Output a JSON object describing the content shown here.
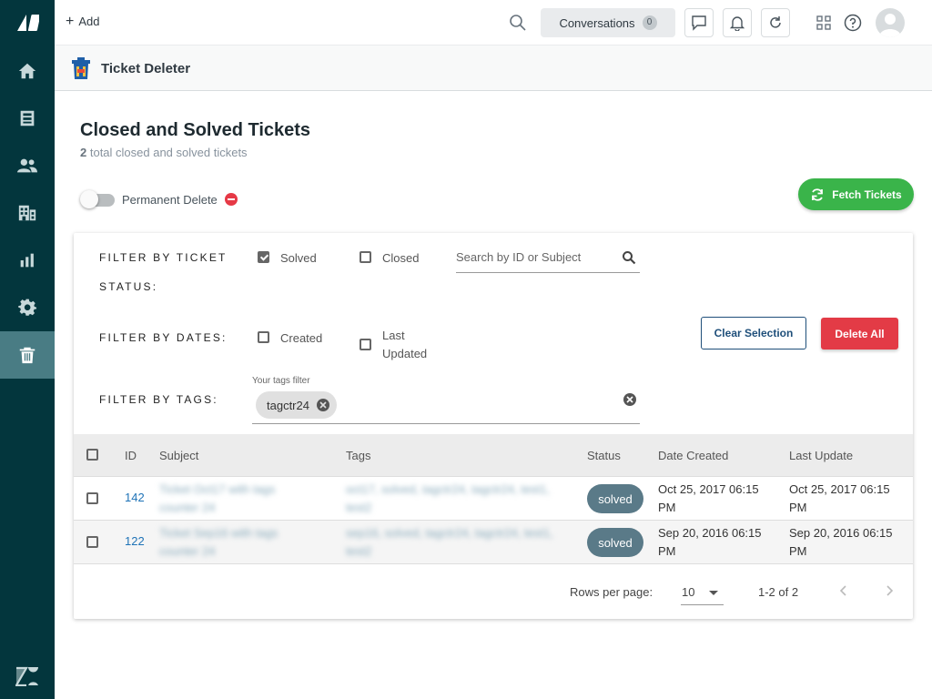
{
  "topbar": {
    "add_label": "Add",
    "conversations_label": "Conversations",
    "conversations_count": "0"
  },
  "app": {
    "title": "Ticket Deleter"
  },
  "page": {
    "title": "Closed and Solved Tickets",
    "total_count": "2",
    "total_suffix": " total closed and solved tickets"
  },
  "toggle": {
    "label": "Permanent Delete",
    "state": "off"
  },
  "fetch_button": "Fetch Tickets",
  "filters": {
    "status_label": "FILTER BY TICKET STATUS:",
    "dates_label": "FILTER BY DATES:",
    "tags_label": "FILTER BY TAGS:",
    "status_options": [
      {
        "label": "Solved",
        "checked": true
      },
      {
        "label": "Closed",
        "checked": false
      }
    ],
    "date_options": [
      {
        "label": "Created",
        "checked": false
      },
      {
        "label": "Last Updated",
        "checked": false
      }
    ],
    "search_placeholder": "Search by ID or Subject",
    "tags_caption": "Your tags filter",
    "tag_chips": [
      "tagctr24"
    ]
  },
  "actions": {
    "clear_label": "Clear Selection",
    "delete_label": "Delete All"
  },
  "table": {
    "columns": [
      "ID",
      "Subject",
      "Tags",
      "Status",
      "Date Created",
      "Last Update"
    ],
    "rows": [
      {
        "id": "142",
        "subject": "Ticket Oct17 with tags counter 24",
        "tags": "oct17, solved, tagctr24, tagctr24, test1, test2",
        "status": "solved",
        "created": "Oct 25, 2017 06:15 PM",
        "updated": "Oct 25, 2017 06:15 PM"
      },
      {
        "id": "122",
        "subject": "Ticket Sep16 with tags counter 24",
        "tags": "sep16, solved, tagctr24, tagctr24, test1, test2",
        "status": "solved",
        "created": "Sep 20, 2016 06:15 PM",
        "updated": "Sep 20, 2016 06:15 PM"
      }
    ]
  },
  "pagination": {
    "rows_per_page_label": "Rows per page:",
    "rows_per_page_value": "10",
    "range": "1-2 of 2"
  },
  "colors": {
    "nav_bg": "#03363d",
    "fetch_green": "#3ab44a",
    "delete_red": "#e33b46",
    "status_pill": "#5a7a88",
    "link_blue": "#1f73b7"
  }
}
